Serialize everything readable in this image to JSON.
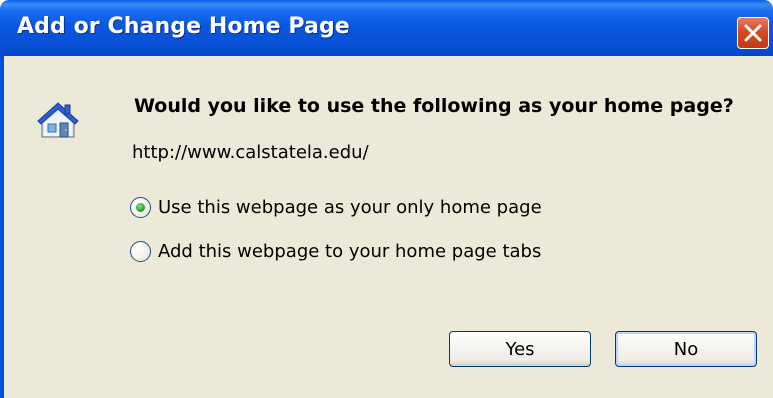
{
  "window": {
    "title": "Add or Change Home Page"
  },
  "icons": {
    "house": "house-icon",
    "close": "close-icon"
  },
  "dialog": {
    "question": "Would you like to use the following as your home page?",
    "url": "http://www.calstatela.edu/",
    "options": [
      {
        "label": "Use this webpage as your only home page",
        "selected": true
      },
      {
        "label": "Add this webpage to your home page tabs",
        "selected": false
      }
    ],
    "buttons": {
      "yes": "Yes",
      "no": "No"
    }
  },
  "colors": {
    "titlebar": "#0a58e0",
    "panel": "#ece9d8",
    "close_button": "#d64b26",
    "radio_selected": "#2fa52f"
  }
}
